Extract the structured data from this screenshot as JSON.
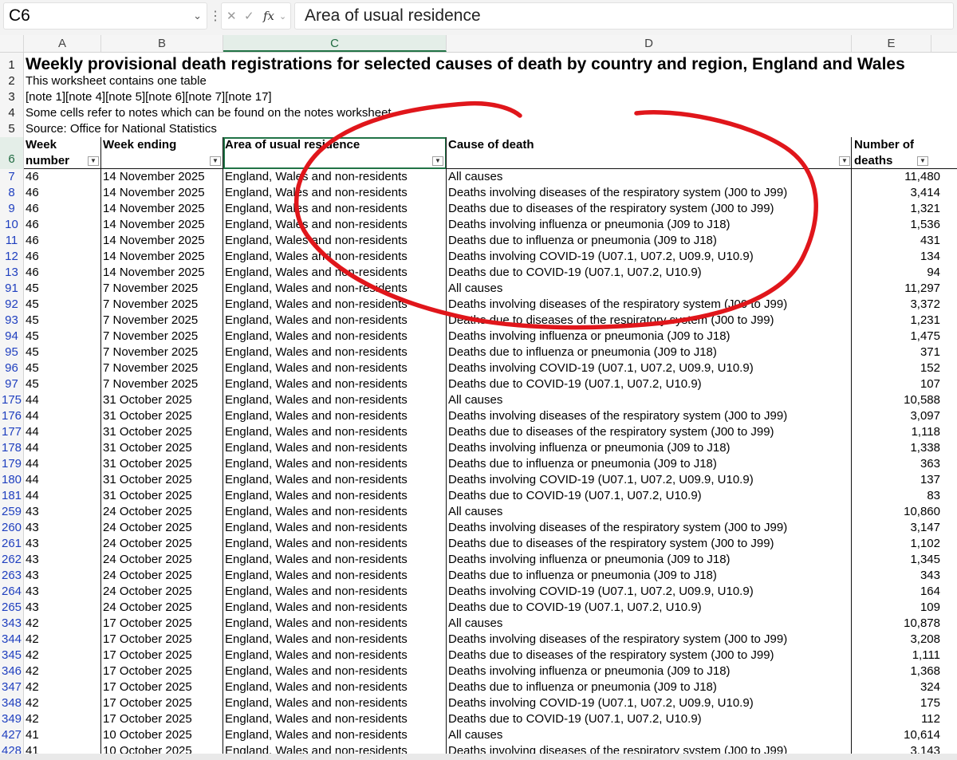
{
  "formula_bar": {
    "name_box": "C6",
    "fx_label": "fx",
    "cancel_icon": "close-icon",
    "enter_icon": "check-icon",
    "content": "Area of usual residence"
  },
  "columns": [
    "A",
    "B",
    "C",
    "D",
    "E"
  ],
  "selected_column": "C",
  "sheet": {
    "title": "Weekly provisional death registrations for selected causes of death by country and region, England and Wales",
    "line2": "This worksheet contains one table",
    "line3": "[note 1][note 4][note 5][note 6][note 7][note 17]",
    "line4": "Some cells refer to notes which can be found on the notes worksheet",
    "line5": "Source: Office for National Statistics"
  },
  "top_row_numbers": [
    "1",
    "2",
    "3",
    "4",
    "5",
    "6"
  ],
  "table": {
    "headers": {
      "week_number_1": "Week",
      "week_number_2": "number",
      "week_ending": "Week ending",
      "area": "Area of usual residence",
      "cause": "Cause of death",
      "deaths_1": "Number of",
      "deaths_2": "deaths"
    },
    "rows": [
      {
        "r": "7",
        "week": "46",
        "ending": "14 November 2025",
        "area": "England, Wales and non-residents",
        "cause": "All causes",
        "deaths": "11,480"
      },
      {
        "r": "8",
        "week": "46",
        "ending": "14 November 2025",
        "area": "England, Wales and non-residents",
        "cause": "Deaths involving diseases of the respiratory system (J00 to J99)",
        "deaths": "3,414"
      },
      {
        "r": "9",
        "week": "46",
        "ending": "14 November 2025",
        "area": "England, Wales and non-residents",
        "cause": "Deaths due to diseases of the respiratory system (J00 to J99)",
        "deaths": "1,321"
      },
      {
        "r": "10",
        "week": "46",
        "ending": "14 November 2025",
        "area": "England, Wales and non-residents",
        "cause": "Deaths involving influenza or pneumonia (J09 to J18)",
        "deaths": "1,536"
      },
      {
        "r": "11",
        "week": "46",
        "ending": "14 November 2025",
        "area": "England, Wales and non-residents",
        "cause": "Deaths due to influenza or pneumonia (J09 to J18)",
        "deaths": "431"
      },
      {
        "r": "12",
        "week": "46",
        "ending": "14 November 2025",
        "area": "England, Wales and non-residents",
        "cause": "Deaths involving COVID-19 (U07.1, U07.2, U09.9, U10.9)",
        "deaths": "134"
      },
      {
        "r": "13",
        "week": "46",
        "ending": "14 November 2025",
        "area": "England, Wales and non-residents",
        "cause": "Deaths due to COVID-19 (U07.1, U07.2, U10.9)",
        "deaths": "94"
      },
      {
        "r": "91",
        "week": "45",
        "ending": "7 November 2025",
        "area": "England, Wales and non-residents",
        "cause": "All causes",
        "deaths": "11,297"
      },
      {
        "r": "92",
        "week": "45",
        "ending": "7 November 2025",
        "area": "England, Wales and non-residents",
        "cause": "Deaths involving diseases of the respiratory system (J00 to J99)",
        "deaths": "3,372"
      },
      {
        "r": "93",
        "week": "45",
        "ending": "7 November 2025",
        "area": "England, Wales and non-residents",
        "cause": "Deaths due to diseases of the respiratory system (J00 to J99)",
        "deaths": "1,231"
      },
      {
        "r": "94",
        "week": "45",
        "ending": "7 November 2025",
        "area": "England, Wales and non-residents",
        "cause": "Deaths involving influenza or pneumonia (J09 to J18)",
        "deaths": "1,475"
      },
      {
        "r": "95",
        "week": "45",
        "ending": "7 November 2025",
        "area": "England, Wales and non-residents",
        "cause": "Deaths due to influenza or pneumonia (J09 to J18)",
        "deaths": "371"
      },
      {
        "r": "96",
        "week": "45",
        "ending": "7 November 2025",
        "area": "England, Wales and non-residents",
        "cause": "Deaths involving COVID-19 (U07.1, U07.2, U09.9, U10.9)",
        "deaths": "152"
      },
      {
        "r": "97",
        "week": "45",
        "ending": "7 November 2025",
        "area": "England, Wales and non-residents",
        "cause": "Deaths due to COVID-19 (U07.1, U07.2, U10.9)",
        "deaths": "107"
      },
      {
        "r": "175",
        "week": "44",
        "ending": "31 October 2025",
        "area": "England, Wales and non-residents",
        "cause": "All causes",
        "deaths": "10,588"
      },
      {
        "r": "176",
        "week": "44",
        "ending": "31 October 2025",
        "area": "England, Wales and non-residents",
        "cause": "Deaths involving diseases of the respiratory system (J00 to J99)",
        "deaths": "3,097"
      },
      {
        "r": "177",
        "week": "44",
        "ending": "31 October 2025",
        "area": "England, Wales and non-residents",
        "cause": "Deaths due to diseases of the respiratory system (J00 to J99)",
        "deaths": "1,118"
      },
      {
        "r": "178",
        "week": "44",
        "ending": "31 October 2025",
        "area": "England, Wales and non-residents",
        "cause": "Deaths involving influenza or pneumonia (J09 to J18)",
        "deaths": "1,338"
      },
      {
        "r": "179",
        "week": "44",
        "ending": "31 October 2025",
        "area": "England, Wales and non-residents",
        "cause": "Deaths due to influenza or pneumonia (J09 to J18)",
        "deaths": "363"
      },
      {
        "r": "180",
        "week": "44",
        "ending": "31 October 2025",
        "area": "England, Wales and non-residents",
        "cause": "Deaths involving COVID-19 (U07.1, U07.2, U09.9, U10.9)",
        "deaths": "137"
      },
      {
        "r": "181",
        "week": "44",
        "ending": "31 October 2025",
        "area": "England, Wales and non-residents",
        "cause": "Deaths due to COVID-19 (U07.1, U07.2, U10.9)",
        "deaths": "83"
      },
      {
        "r": "259",
        "week": "43",
        "ending": "24 October 2025",
        "area": "England, Wales and non-residents",
        "cause": "All causes",
        "deaths": "10,860"
      },
      {
        "r": "260",
        "week": "43",
        "ending": "24 October 2025",
        "area": "England, Wales and non-residents",
        "cause": "Deaths involving diseases of the respiratory system (J00 to J99)",
        "deaths": "3,147"
      },
      {
        "r": "261",
        "week": "43",
        "ending": "24 October 2025",
        "area": "England, Wales and non-residents",
        "cause": "Deaths due to diseases of the respiratory system (J00 to J99)",
        "deaths": "1,102"
      },
      {
        "r": "262",
        "week": "43",
        "ending": "24 October 2025",
        "area": "England, Wales and non-residents",
        "cause": "Deaths involving influenza or pneumonia (J09 to J18)",
        "deaths": "1,345"
      },
      {
        "r": "263",
        "week": "43",
        "ending": "24 October 2025",
        "area": "England, Wales and non-residents",
        "cause": "Deaths due to influenza or pneumonia (J09 to J18)",
        "deaths": "343"
      },
      {
        "r": "264",
        "week": "43",
        "ending": "24 October 2025",
        "area": "England, Wales and non-residents",
        "cause": "Deaths involving COVID-19 (U07.1, U07.2, U09.9, U10.9)",
        "deaths": "164"
      },
      {
        "r": "265",
        "week": "43",
        "ending": "24 October 2025",
        "area": "England, Wales and non-residents",
        "cause": "Deaths due to COVID-19 (U07.1, U07.2, U10.9)",
        "deaths": "109"
      },
      {
        "r": "343",
        "week": "42",
        "ending": "17 October 2025",
        "area": "England, Wales and non-residents",
        "cause": "All causes",
        "deaths": "10,878"
      },
      {
        "r": "344",
        "week": "42",
        "ending": "17 October 2025",
        "area": "England, Wales and non-residents",
        "cause": "Deaths involving diseases of the respiratory system (J00 to J99)",
        "deaths": "3,208"
      },
      {
        "r": "345",
        "week": "42",
        "ending": "17 October 2025",
        "area": "England, Wales and non-residents",
        "cause": "Deaths due to diseases of the respiratory system (J00 to J99)",
        "deaths": "1,111"
      },
      {
        "r": "346",
        "week": "42",
        "ending": "17 October 2025",
        "area": "England, Wales and non-residents",
        "cause": "Deaths involving influenza or pneumonia (J09 to J18)",
        "deaths": "1,368"
      },
      {
        "r": "347",
        "week": "42",
        "ending": "17 October 2025",
        "area": "England, Wales and non-residents",
        "cause": "Deaths due to influenza or pneumonia (J09 to J18)",
        "deaths": "324"
      },
      {
        "r": "348",
        "week": "42",
        "ending": "17 October 2025",
        "area": "England, Wales and non-residents",
        "cause": "Deaths involving COVID-19 (U07.1, U07.2, U09.9, U10.9)",
        "deaths": "175"
      },
      {
        "r": "349",
        "week": "42",
        "ending": "17 October 2025",
        "area": "England, Wales and non-residents",
        "cause": "Deaths due to COVID-19 (U07.1, U07.2, U10.9)",
        "deaths": "112"
      },
      {
        "r": "427",
        "week": "41",
        "ending": "10 October 2025",
        "area": "England, Wales and non-residents",
        "cause": "All causes",
        "deaths": "10,614"
      },
      {
        "r": "428",
        "week": "41",
        "ending": "10 October 2025",
        "area": "England, Wales and non-residents",
        "cause": "Deaths involving diseases of the respiratory system (J00 to J99)",
        "deaths": "3,143"
      }
    ]
  },
  "colors": {
    "selection_green": "#217346",
    "filtered_row_number": "#1f3fbf",
    "annotation_red": "#e0161b"
  }
}
